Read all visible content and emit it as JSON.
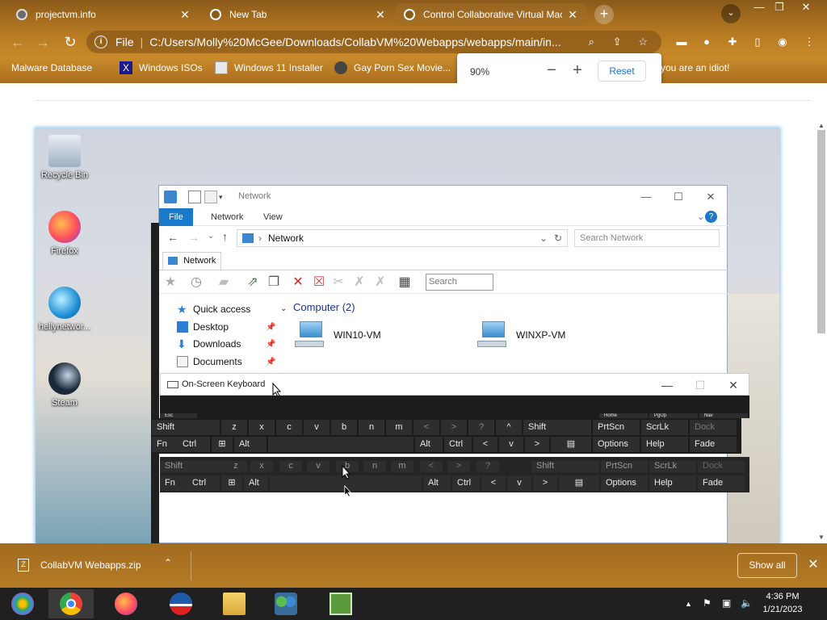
{
  "browser": {
    "tabs": [
      {
        "label": "projectvm.info",
        "active": false
      },
      {
        "label": "New Tab",
        "active": false
      },
      {
        "label": "Control Collaborative Virtual Mac",
        "active": true
      }
    ],
    "address": {
      "scheme_label": "File",
      "url": "C:/Users/Molly%20McGee/Downloads/CollabVM%20Webapps/webapps/main/in..."
    },
    "bookmarks": [
      "Malware Database",
      "Windows ISOs",
      "Windows 11 Installer",
      "Gay Porn Sex Movie...",
      "you are an idiot!"
    ],
    "zoom_popup": {
      "level": "90%",
      "minus": "−",
      "plus": "+",
      "reset": "Reset"
    }
  },
  "desktop": {
    "icons": [
      "Recycle Bin",
      "Firefox",
      "hellynetwor...",
      "Steam"
    ]
  },
  "explorer": {
    "title": "Network",
    "ribbon_tabs": [
      "File",
      "Network",
      "View"
    ],
    "address": "Network",
    "search_placeholder": "Search Network",
    "legacy_tab": "Network",
    "legacy_search_placeholder": "Search",
    "nav_items": [
      {
        "label": "Quick access",
        "pinned": false
      },
      {
        "label": "Desktop",
        "pinned": true
      },
      {
        "label": "Downloads",
        "pinned": true
      },
      {
        "label": "Documents",
        "pinned": true
      }
    ],
    "group_header": "Computer (2)",
    "computers": [
      "WIN10-VM",
      "WINXP-VM"
    ]
  },
  "osk": {
    "title": "On-Screen Keyboard",
    "partial_row": [
      "Esc",
      "Home",
      "PgUp",
      "Nav"
    ],
    "row1": [
      "Shift",
      "z",
      "x",
      "c",
      "v",
      "b",
      "n",
      "m",
      "<",
      ">",
      "?",
      "^",
      "Shift",
      "PrtScn",
      "ScrLk",
      "Dock"
    ],
    "row1_sub": [
      ",",
      ".",
      "/"
    ],
    "row2": [
      "Fn",
      "Ctrl",
      "Alt",
      "Alt",
      "Ctrl",
      "<",
      "v",
      ">",
      "Options",
      "Help",
      "Fade"
    ],
    "ghost_row1": [
      "Shift",
      "z",
      "x",
      "c",
      "v",
      "b",
      "n",
      "m",
      "<",
      ">",
      "?",
      "Shift",
      "PrtScn",
      "ScrLk",
      "Dock"
    ],
    "ghost_row2": [
      "Fn",
      "Ctrl",
      "Alt",
      "Alt",
      "Ctrl",
      "<",
      "v",
      ">",
      "Options",
      "Help",
      "Fade"
    ]
  },
  "download_bar": {
    "file": "CollabVM Webapps.zip",
    "show_all": "Show all"
  },
  "taskbar": {
    "time": "4:36 PM",
    "date": "1/21/2023"
  }
}
